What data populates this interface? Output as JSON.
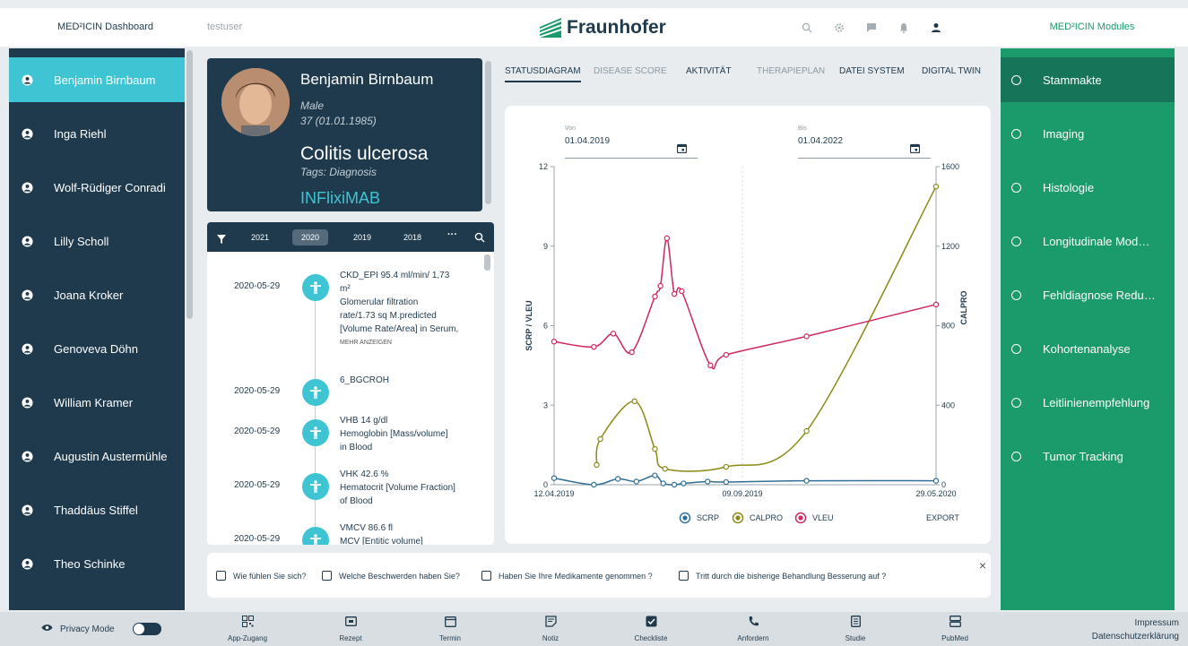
{
  "topbar": {
    "left_label": "MED²ICIN Dashboard",
    "user": "testuser",
    "logo": "Fraunhofer",
    "right_label": "MED²ICIN Modules",
    "icons": [
      "search-icon",
      "gear-icon",
      "chat-icon",
      "bell-icon",
      "user-icon"
    ]
  },
  "patients": [
    {
      "name": "Benjamin Birnbaum",
      "active": true
    },
    {
      "name": "Inga Riehl"
    },
    {
      "name": "Wolf-Rüdiger Conradi"
    },
    {
      "name": "Lilly Scholl"
    },
    {
      "name": "Joana Kroker"
    },
    {
      "name": "Genoveva Döhn"
    },
    {
      "name": "William Kramer"
    },
    {
      "name": "Augustin Austermühle"
    },
    {
      "name": "Thaddäus Stiffel"
    },
    {
      "name": "Theo Schinke"
    }
  ],
  "patient_card": {
    "name": "Benjamin Birnbaum",
    "gender": "Male",
    "age": "37 (01.01.1985)",
    "diagnosis": "Colitis ulcerosa",
    "tags": "Tags: Diagnosis",
    "drug": "INFlixiMAB"
  },
  "timeline": {
    "years": [
      "2021",
      "2020",
      "2019",
      "2018"
    ],
    "active_year": "2020",
    "entries": [
      {
        "date": "2020-05-29",
        "lines": [
          "CKD_EPI 95.4 ml/min/ 1,73",
          "m²",
          "Glomerular filtration",
          "rate/1.73 sq M.predicted",
          "[Volume Rate/Area] in Serum,"
        ],
        "more": "MEHR ANZEIGEN"
      },
      {
        "date": "2020-05-29",
        "lines": [
          "6_BGCROH"
        ]
      },
      {
        "date": "2020-05-29",
        "lines": [
          "VHB 14 g/dl",
          "Hemoglobin [Mass/volume]",
          "in Blood"
        ]
      },
      {
        "date": "2020-05-29",
        "lines": [
          "VHK 42.6 %",
          "Hematocrit [Volume Fraction]",
          "of Blood"
        ]
      },
      {
        "date": "2020-05-29",
        "lines": [
          "VMCV 86.6 fl",
          "MCV [Entitic volume]"
        ]
      }
    ]
  },
  "tabs": [
    {
      "label": "STATUSDIAGRAM",
      "active": true
    },
    {
      "label": "DISEASE SCORE",
      "muted": true
    },
    {
      "label": "AKTIVITÄT"
    },
    {
      "label": "THERAPIEPLAN",
      "muted": true
    },
    {
      "label": "DATEI SYSTEM"
    },
    {
      "label": "DIGITAL TWIN"
    }
  ],
  "date_range": {
    "from_label": "Von",
    "from_value": "01.04.2019",
    "to_label": "Bis",
    "to_value": "01.04.2022"
  },
  "export_label": "EXPORT",
  "chart_data": {
    "type": "line",
    "ylabel_left": "SCRP / VLEU",
    "ylabel_right": "CALPRO",
    "y_left_ticks": [
      "0",
      "3",
      "6",
      "9",
      "12"
    ],
    "y_right_ticks": [
      "0",
      "400",
      "800",
      "1200",
      "1600"
    ],
    "ylim_left": [
      0,
      12
    ],
    "ylim_right": [
      0,
      1600
    ],
    "x_ticks": [
      "12.04.2019",
      "09.09.2019",
      "29.05.2020"
    ],
    "xlim": [
      "2019-04-12",
      "2020-05-29"
    ],
    "grid": true,
    "legend_position": "bottom",
    "series": [
      {
        "name": "SCRP",
        "axis": "left",
        "color": "#2f6f95",
        "points": [
          [
            "2019-04-12",
            0.25
          ],
          [
            "2019-05-25",
            0.0
          ],
          [
            "2019-06-20",
            0.22
          ],
          [
            "2019-07-10",
            0.12
          ],
          [
            "2019-07-30",
            0.35
          ],
          [
            "2019-08-08",
            0.05
          ],
          [
            "2019-08-20",
            0.0
          ],
          [
            "2019-08-30",
            0.05
          ],
          [
            "2019-09-25",
            0.12
          ],
          [
            "2019-10-15",
            0.1
          ],
          [
            "2020-01-10",
            0.15
          ],
          [
            "2020-05-29",
            0.15
          ]
        ]
      },
      {
        "name": "CALPRO",
        "axis": "right",
        "color": "#8a8a14",
        "points": [
          [
            "2019-05-28",
            100
          ],
          [
            "2019-06-01",
            230
          ],
          [
            "2019-07-08",
            420
          ],
          [
            "2019-07-30",
            180
          ],
          [
            "2019-08-10",
            80
          ],
          [
            "2019-10-15",
            90
          ],
          [
            "2020-01-10",
            270
          ],
          [
            "2020-05-29",
            1500
          ]
        ]
      },
      {
        "name": "VLEU",
        "axis": "left",
        "color": "#d0275e",
        "points": [
          [
            "2019-04-12",
            5.4
          ],
          [
            "2019-05-25",
            5.2
          ],
          [
            "2019-06-15",
            5.7
          ],
          [
            "2019-07-05",
            5.0
          ],
          [
            "2019-07-30",
            7.1
          ],
          [
            "2019-08-05",
            7.5
          ],
          [
            "2019-08-12",
            9.3
          ],
          [
            "2019-08-20",
            7.2
          ],
          [
            "2019-08-28",
            7.3
          ],
          [
            "2019-09-28",
            4.5
          ],
          [
            "2019-10-15",
            4.9
          ],
          [
            "2020-01-10",
            5.6
          ],
          [
            "2020-05-29",
            6.8
          ]
        ]
      }
    ]
  },
  "questionnaire": {
    "items": [
      "Wie fühlen Sie sich?",
      "Welche Beschwerden haben Sie?",
      "Haben Sie Ihre Medikamente genommen ?",
      "Tritt durch die bisherige Behandlung Besserung auf ?"
    ],
    "close": "×"
  },
  "modules": [
    {
      "label": "Stammakte",
      "active": true
    },
    {
      "label": "Imaging"
    },
    {
      "label": "Histologie"
    },
    {
      "label": "Longitudinale Modell..."
    },
    {
      "label": "Fehldiagnose Reduzi..."
    },
    {
      "label": "Kohortenanalyse"
    },
    {
      "label": "Leitlinienempfehlung"
    },
    {
      "label": "Tumor Tracking"
    }
  ],
  "bottombar": {
    "privacy_label": "Privacy Mode",
    "items": [
      "App-Zugang",
      "Rezept",
      "Termin",
      "Notiz",
      "Checkliste",
      "Anfordern",
      "Studie",
      "PubMed"
    ],
    "impressum": "Impressum",
    "datenschutz": "Datenschutzerklärung"
  }
}
